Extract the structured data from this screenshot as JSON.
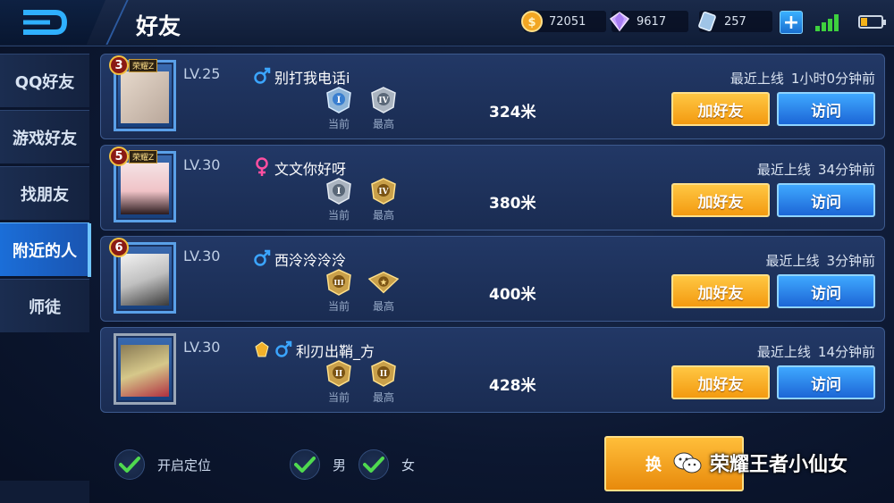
{
  "header": {
    "title": "好友",
    "gold": "72051",
    "diamonds": "9617",
    "tickets": "257"
  },
  "sidebar": {
    "items": [
      {
        "label": "QQ好友",
        "active": false
      },
      {
        "label": "游戏好友",
        "active": false
      },
      {
        "label": "找朋友",
        "active": false
      },
      {
        "label": "附近的人",
        "active": true
      },
      {
        "label": "师徒",
        "active": false
      }
    ]
  },
  "players": [
    {
      "rank_badge": "3",
      "frame_tag": "荣耀Z",
      "level": "LV.25",
      "gender": "male",
      "name": "别打我电话i",
      "tier_current": "I",
      "tier_highest": "IV",
      "distance": "324米",
      "last_online_label": "最近上线",
      "last_online_value": "1小时0分钟前"
    },
    {
      "rank_badge": "5",
      "frame_tag": "荣耀Z",
      "level": "LV.30",
      "gender": "female",
      "name": "文文你好呀",
      "tier_current": "I",
      "tier_highest": "IV",
      "distance": "380米",
      "last_online_label": "最近上线",
      "last_online_value": "34分钟前"
    },
    {
      "rank_badge": "6",
      "frame_tag": "",
      "level": "LV.30",
      "gender": "male",
      "name": "西泠泠泠泠",
      "tier_current": "III",
      "tier_highest": "★",
      "distance": "400米",
      "last_online_label": "最近上线",
      "last_online_value": "3分钟前"
    },
    {
      "rank_badge": "",
      "frame_tag": "",
      "level": "LV.30",
      "gender": "male",
      "name": "利刃出鞘_方",
      "tier_current": "II",
      "tier_highest": "II",
      "distance": "428米",
      "last_online_label": "最近上线",
      "last_online_value": "14分钟前"
    }
  ],
  "labels": {
    "current": "当前",
    "highest": "最高",
    "add_friend": "加好友",
    "visit": "访问"
  },
  "filters": {
    "location": "开启定位",
    "male": "男",
    "female": "女"
  },
  "change_button": "换",
  "watermark": "荣耀王者小仙女",
  "colors": {
    "add_button": "#f5a41c",
    "visit_button": "#2a86e8",
    "active_tab": "#1b6ed8",
    "male": "#3ba5ff",
    "female": "#ff4fa0",
    "check": "#4fd94f"
  }
}
